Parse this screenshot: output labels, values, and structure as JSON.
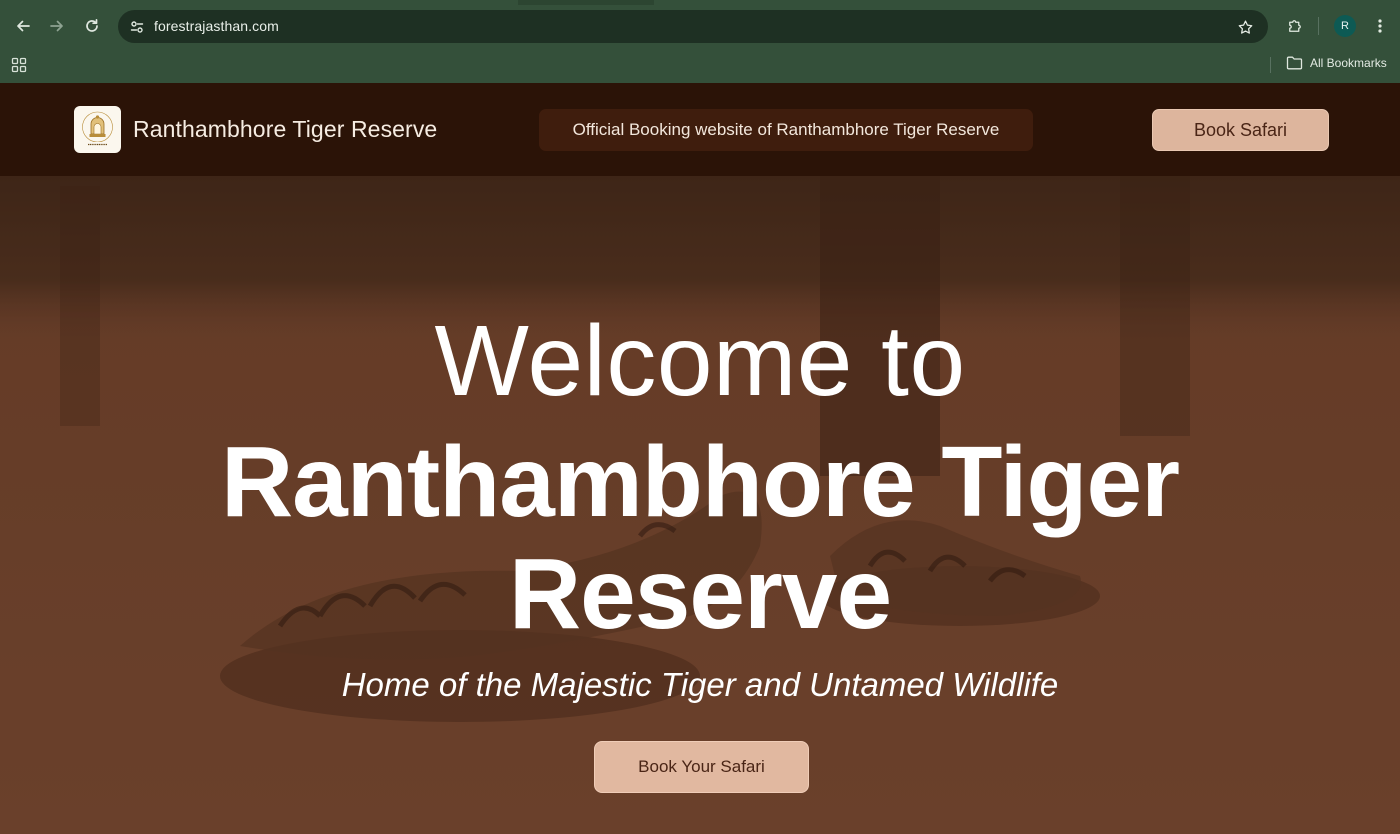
{
  "browser": {
    "url": "forestrajasthan.com",
    "profile_initial": "R",
    "bookmarks_label": "All Bookmarks",
    "icons": {
      "back": "arrow-left-icon",
      "forward": "arrow-right-icon",
      "reload": "reload-icon",
      "site_info": "tune-icon",
      "bookmark_star": "star-icon",
      "extensions": "puzzle-icon",
      "menu": "kebab-menu-icon",
      "apps": "apps-grid-icon",
      "folder": "folder-icon"
    }
  },
  "header": {
    "logo_alt": "RAJASTHAN",
    "logo_ring_text": "RANTHAMBHORE TIGER RESERVE",
    "site_title": "Ranthambhore Tiger Reserve",
    "official_text": "Official Booking website of Ranthambhore Tiger Reserve",
    "book_button": "Book Safari"
  },
  "hero": {
    "welcome": "Welcome to",
    "name_line1": "Ranthambhore Tiger",
    "name_line2": "Reserve",
    "tagline": "Home of the Majestic Tiger and Untamed Wildlife",
    "cta": "Book Your Safari"
  },
  "colors": {
    "chrome_bg": "#34503a",
    "omnibox_bg": "#1e3023",
    "header_bg": "#2b1307",
    "pill_bg": "#3f1d0d",
    "button_bg": "#ddb59d",
    "button_text": "#4a2516",
    "avatar_bg": "#0d5a54"
  }
}
